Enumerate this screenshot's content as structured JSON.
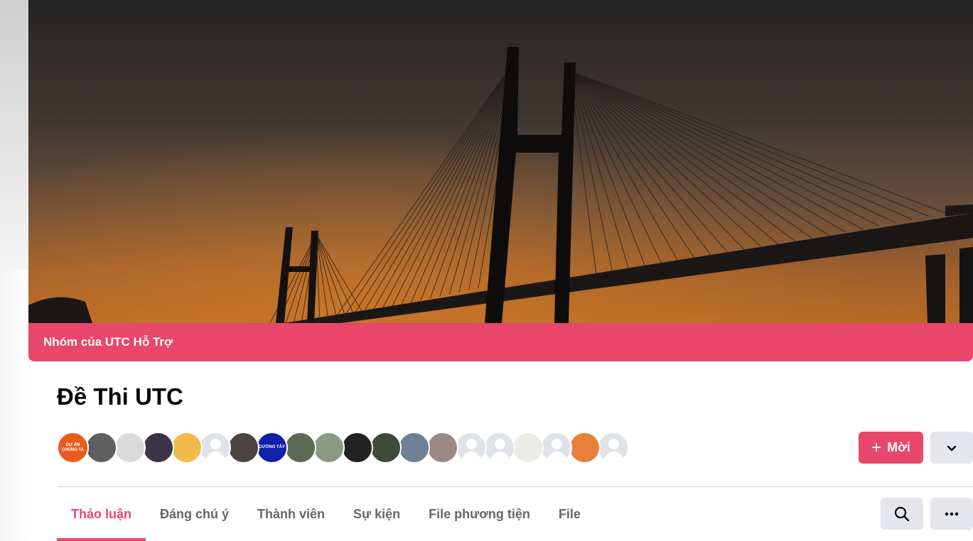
{
  "cover": {
    "banner_label": "Nhóm của UTC Hỗ Trợ"
  },
  "group": {
    "title": "Đề Thi UTC"
  },
  "members": {
    "avatars": [
      {
        "kind": "photo",
        "color": "#e85a1e",
        "text": "DỰ ÁN CHÚNG TA"
      },
      {
        "kind": "photo",
        "color": "#5f5f5f",
        "text": ""
      },
      {
        "kind": "photo",
        "color": "#d9d9d9",
        "text": ""
      },
      {
        "kind": "photo",
        "color": "#3d3346",
        "text": ""
      },
      {
        "kind": "photo",
        "color": "#f1b94a",
        "text": ""
      },
      {
        "kind": "default",
        "color": "#dfe3e8",
        "text": ""
      },
      {
        "kind": "photo",
        "color": "#4b4443",
        "text": ""
      },
      {
        "kind": "photo",
        "color": "#1020a8",
        "text": "CƯỜNG TÂY"
      },
      {
        "kind": "photo",
        "color": "#5d6b53",
        "text": ""
      },
      {
        "kind": "photo",
        "color": "#8b9a83",
        "text": ""
      },
      {
        "kind": "photo",
        "color": "#222222",
        "text": ""
      },
      {
        "kind": "photo",
        "color": "#3f4a3a",
        "text": ""
      },
      {
        "kind": "photo",
        "color": "#6f7f94",
        "text": ""
      },
      {
        "kind": "photo",
        "color": "#9a8a84",
        "text": ""
      },
      {
        "kind": "default",
        "color": "#dfe3e8",
        "text": ""
      },
      {
        "kind": "default",
        "color": "#dfe3e8",
        "text": ""
      },
      {
        "kind": "photo",
        "color": "#ecebe6",
        "text": ""
      },
      {
        "kind": "default",
        "color": "#dfe3e8",
        "text": ""
      },
      {
        "kind": "photo",
        "color": "#e7803a",
        "text": ""
      },
      {
        "kind": "default",
        "color": "#dfe3e8",
        "text": ""
      }
    ]
  },
  "actions": {
    "invite_label": "Mời",
    "invite_icon": "plus-icon",
    "more_icon": "chevron-down-icon"
  },
  "tabs": [
    {
      "label": "Thảo luận",
      "active": true
    },
    {
      "label": "Đáng chú ý",
      "active": false
    },
    {
      "label": "Thành viên",
      "active": false
    },
    {
      "label": "Sự kiện",
      "active": false
    },
    {
      "label": "File phương tiện",
      "active": false
    },
    {
      "label": "File",
      "active": false
    }
  ],
  "toolbar": {
    "search_icon": "search-icon",
    "more_icon": "more-dots-icon"
  },
  "colors": {
    "accent": "#e8466a",
    "button_grey": "#e4e6eb",
    "tab_text": "#65676b"
  }
}
